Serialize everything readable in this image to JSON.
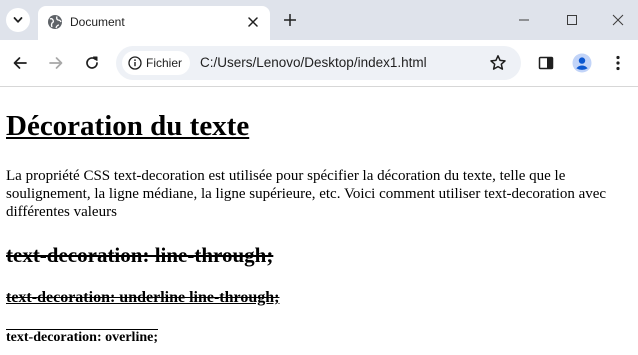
{
  "browser": {
    "tab": {
      "title": "Document"
    },
    "omnibox": {
      "security_label": "Fichier",
      "url": "C:/Users/Lenovo/Desktop/index1.html"
    }
  },
  "page": {
    "heading": "Décoration du texte",
    "paragraph": "La propriété CSS text-decoration est utilisée pour spécifier la décoration du texte, telle que le soulignement, la ligne médiane, la ligne supérieure, etc. Voici comment utiliser text-decoration avec différentes valeurs",
    "example_line_through": "text-decoration: line-through;",
    "example_underline_line_through": "text-decoration: underline line-through;",
    "example_overline": "text-decoration: overline;"
  },
  "colors": {
    "tabstrip_bg": "#dfe3eb",
    "omnibox_bg": "#eef1f6",
    "icon_color": "#474747",
    "profile_accent": "#0b57d0"
  }
}
